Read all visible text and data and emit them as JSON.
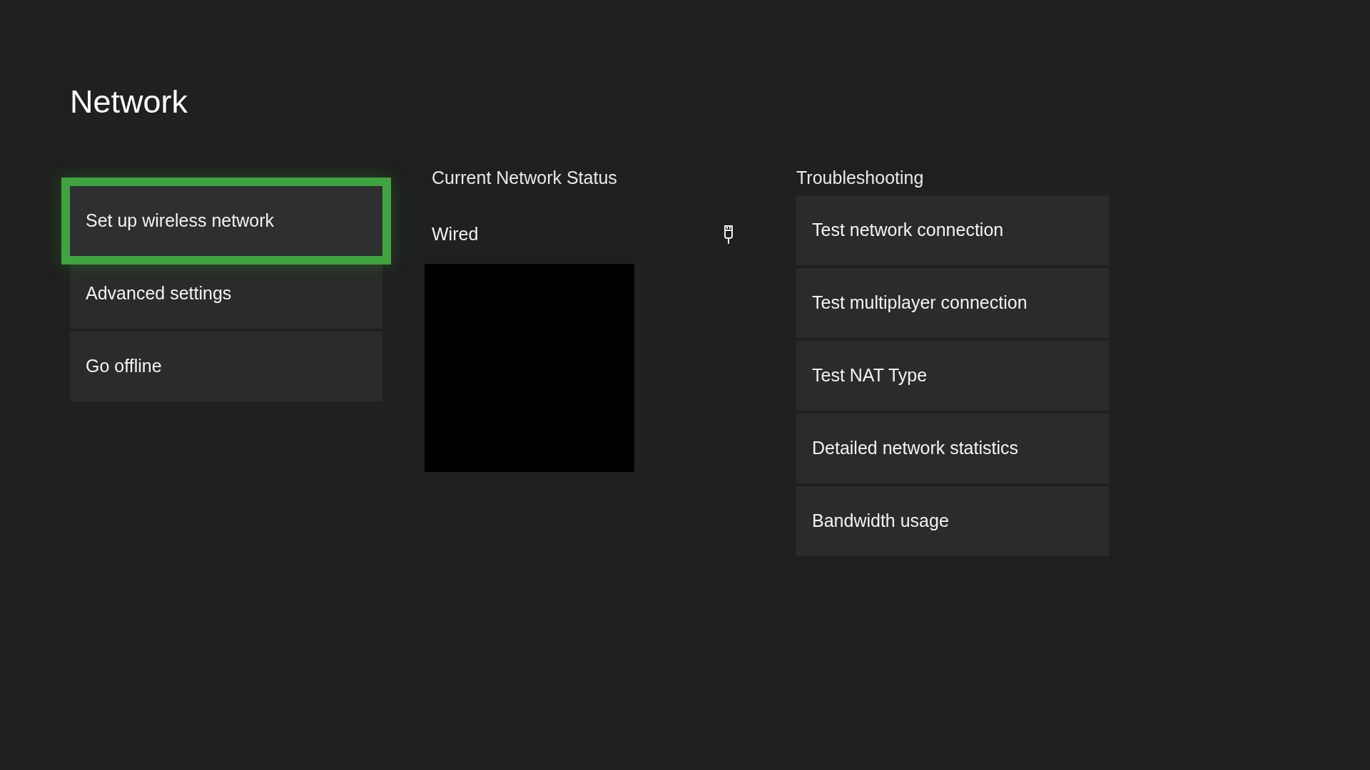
{
  "title": "Network",
  "menu": [
    {
      "label": "Set up wireless network",
      "selected": true
    },
    {
      "label": "Advanced settings",
      "selected": false
    },
    {
      "label": "Go offline",
      "selected": false
    }
  ],
  "status": {
    "heading": "Current Network Status",
    "connection": "Wired"
  },
  "troubleshooting": {
    "heading": "Troubleshooting",
    "items": [
      {
        "label": "Test network connection",
        "selected": false
      },
      {
        "label": "Test multiplayer connection",
        "selected": false
      },
      {
        "label": "Test NAT Type",
        "selected": false
      },
      {
        "label": "Detailed network statistics",
        "selected": false
      },
      {
        "label": "Bandwidth usage",
        "selected": false
      }
    ]
  }
}
